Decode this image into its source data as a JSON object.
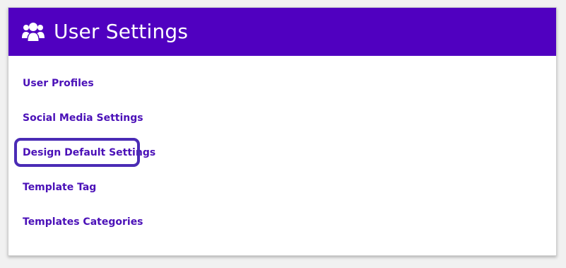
{
  "header": {
    "title": "User Settings",
    "icon": "users-icon"
  },
  "menu": {
    "items": [
      {
        "label": "User Profiles"
      },
      {
        "label": "Social Media Settings"
      },
      {
        "label": "Design Default Settings",
        "focused": true
      },
      {
        "label": "Template Tag"
      },
      {
        "label": "Templates Categories"
      }
    ]
  },
  "colors": {
    "header_bg": "#5000c0",
    "link": "#4b11b8",
    "focus_ring": "#4a2bb5",
    "page_bg": "#f1f1f1"
  }
}
